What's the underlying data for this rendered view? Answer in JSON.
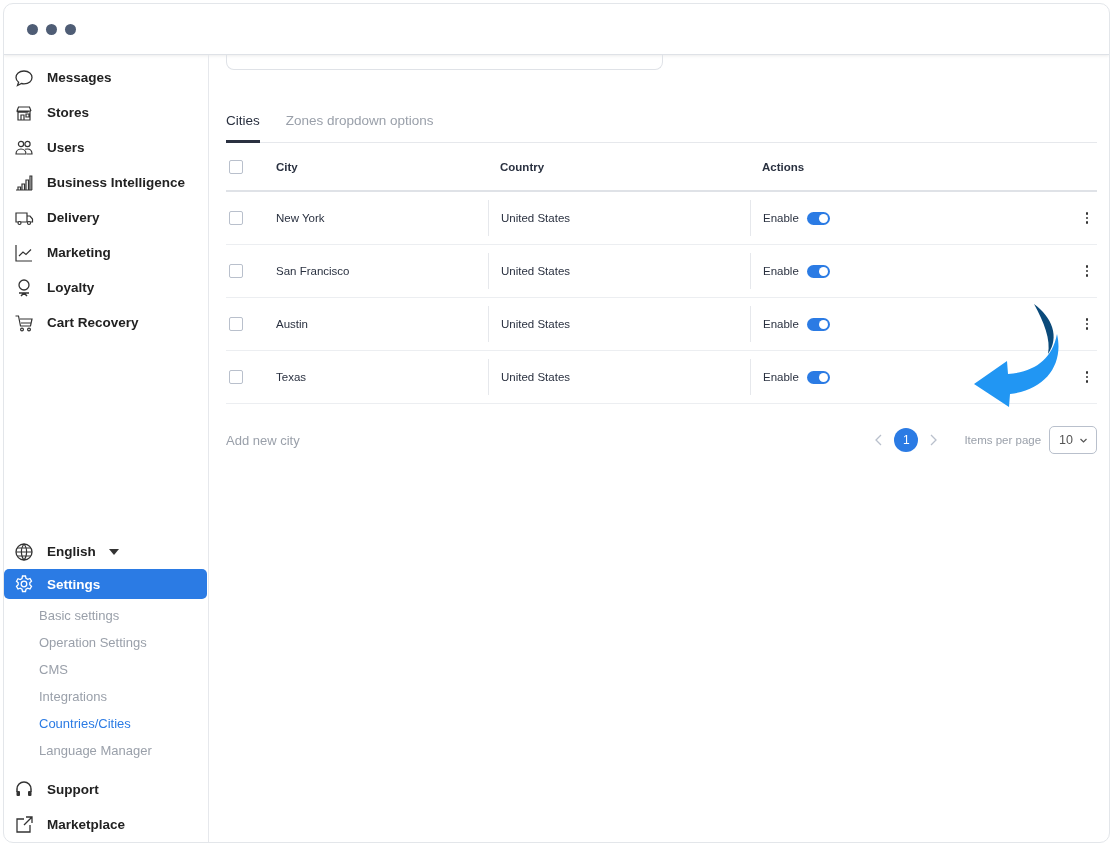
{
  "sidebar": {
    "nav": [
      {
        "label": "Messages",
        "kind": "chat",
        "selected": false
      },
      {
        "label": "Stores",
        "kind": "store",
        "selected": false
      },
      {
        "label": "Users",
        "kind": "users",
        "selected": false
      },
      {
        "label": "Business Intelligence",
        "kind": "bars",
        "selected": false
      },
      {
        "label": "Delivery",
        "kind": "truck",
        "selected": false
      },
      {
        "label": "Marketing",
        "kind": "trend",
        "selected": false
      },
      {
        "label": "Loyalty",
        "kind": "award",
        "selected": false
      },
      {
        "label": "Cart Recovery",
        "kind": "cart",
        "selected": false
      }
    ],
    "language": {
      "label": "English",
      "kind": "globe"
    },
    "settings": {
      "label": "Settings",
      "kind": "gear",
      "selected": true,
      "children": [
        {
          "label": "Basic settings",
          "selected": false
        },
        {
          "label": "Operation Settings",
          "selected": false
        },
        {
          "label": "CMS",
          "selected": false
        },
        {
          "label": "Integrations",
          "selected": false
        },
        {
          "label": "Countries/Cities",
          "selected": true
        },
        {
          "label": "Language Manager",
          "selected": false
        }
      ]
    },
    "bottom": [
      {
        "label": "Support",
        "kind": "headset",
        "selected": false
      },
      {
        "label": "Marketplace",
        "kind": "external",
        "selected": false
      }
    ]
  },
  "tabs": [
    {
      "label": "Cities",
      "selected": true
    },
    {
      "label": "Zones dropdown options",
      "selected": false
    }
  ],
  "table": {
    "header_checked": false,
    "columns": [
      "City",
      "Country",
      "Actions"
    ],
    "rows": [
      {
        "checked": false,
        "city": "New York",
        "country": "United States",
        "action_label": "Enable",
        "enabled": true
      },
      {
        "checked": false,
        "city": "San Francisco",
        "country": "United States",
        "action_label": "Enable",
        "enabled": true
      },
      {
        "checked": false,
        "city": "Austin",
        "country": "United States",
        "action_label": "Enable",
        "enabled": true
      },
      {
        "checked": false,
        "city": "Texas",
        "country": "United States",
        "action_label": "Enable",
        "enabled": true
      }
    ]
  },
  "footer": {
    "add_link": "Add new city",
    "pages": [
      {
        "label": "1",
        "selected": true
      }
    ],
    "items_per_page_label": "Items per page",
    "items_per_page": "10"
  }
}
